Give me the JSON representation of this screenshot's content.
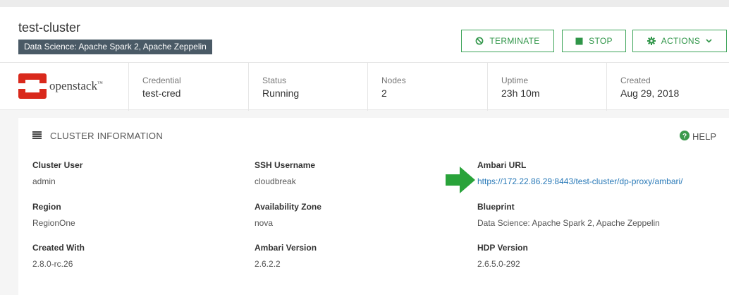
{
  "header": {
    "cluster_name": "test-cluster",
    "blueprint_badge": "Data Science: Apache Spark 2, Apache Zeppelin",
    "buttons": {
      "terminate": "TERMINATE",
      "stop": "STOP",
      "actions": "ACTIONS"
    }
  },
  "summary": {
    "logo_text": "openstack",
    "logo_mark": "™",
    "items": [
      {
        "label": "Credential",
        "value": "test-cred"
      },
      {
        "label": "Status",
        "value": "Running"
      },
      {
        "label": "Nodes",
        "value": "2"
      },
      {
        "label": "Uptime",
        "value": "23h 10m"
      },
      {
        "label": "Created",
        "value": "Aug 29, 2018"
      }
    ]
  },
  "cluster_info": {
    "title": "CLUSTER INFORMATION",
    "help": "HELP",
    "fields": {
      "cluster_user": {
        "label": "Cluster User",
        "value": "admin"
      },
      "ssh_username": {
        "label": "SSH Username",
        "value": "cloudbreak"
      },
      "ambari_url": {
        "label": "Ambari URL",
        "value": "https://172.22.86.29:8443/test-cluster/dp-proxy/ambari/"
      },
      "region": {
        "label": "Region",
        "value": "RegionOne"
      },
      "availability_zone": {
        "label": "Availability Zone",
        "value": "nova"
      },
      "blueprint": {
        "label": "Blueprint",
        "value": "Data Science: Apache Spark 2, Apache Zeppelin"
      },
      "created_with": {
        "label": "Created With",
        "value": "2.8.0-rc.26"
      },
      "ambari_version": {
        "label": "Ambari Version",
        "value": "2.6.2.2"
      },
      "hdp_version": {
        "label": "HDP Version",
        "value": "2.6.5.0-292"
      }
    }
  },
  "colors": {
    "accent_green": "#2f9548",
    "badge_bg": "#4a5a66",
    "link_blue": "#2a7ab8",
    "openstack_red": "#d9291c",
    "arrow_green": "#29a33a"
  },
  "icons": {
    "terminate": "ban-icon",
    "stop": "stop-square-icon",
    "actions": "gear-icon",
    "actions_caret": "chevron-down-icon",
    "section": "list-icon",
    "help": "question-circle-icon",
    "pointer": "arrow-right-icon"
  }
}
